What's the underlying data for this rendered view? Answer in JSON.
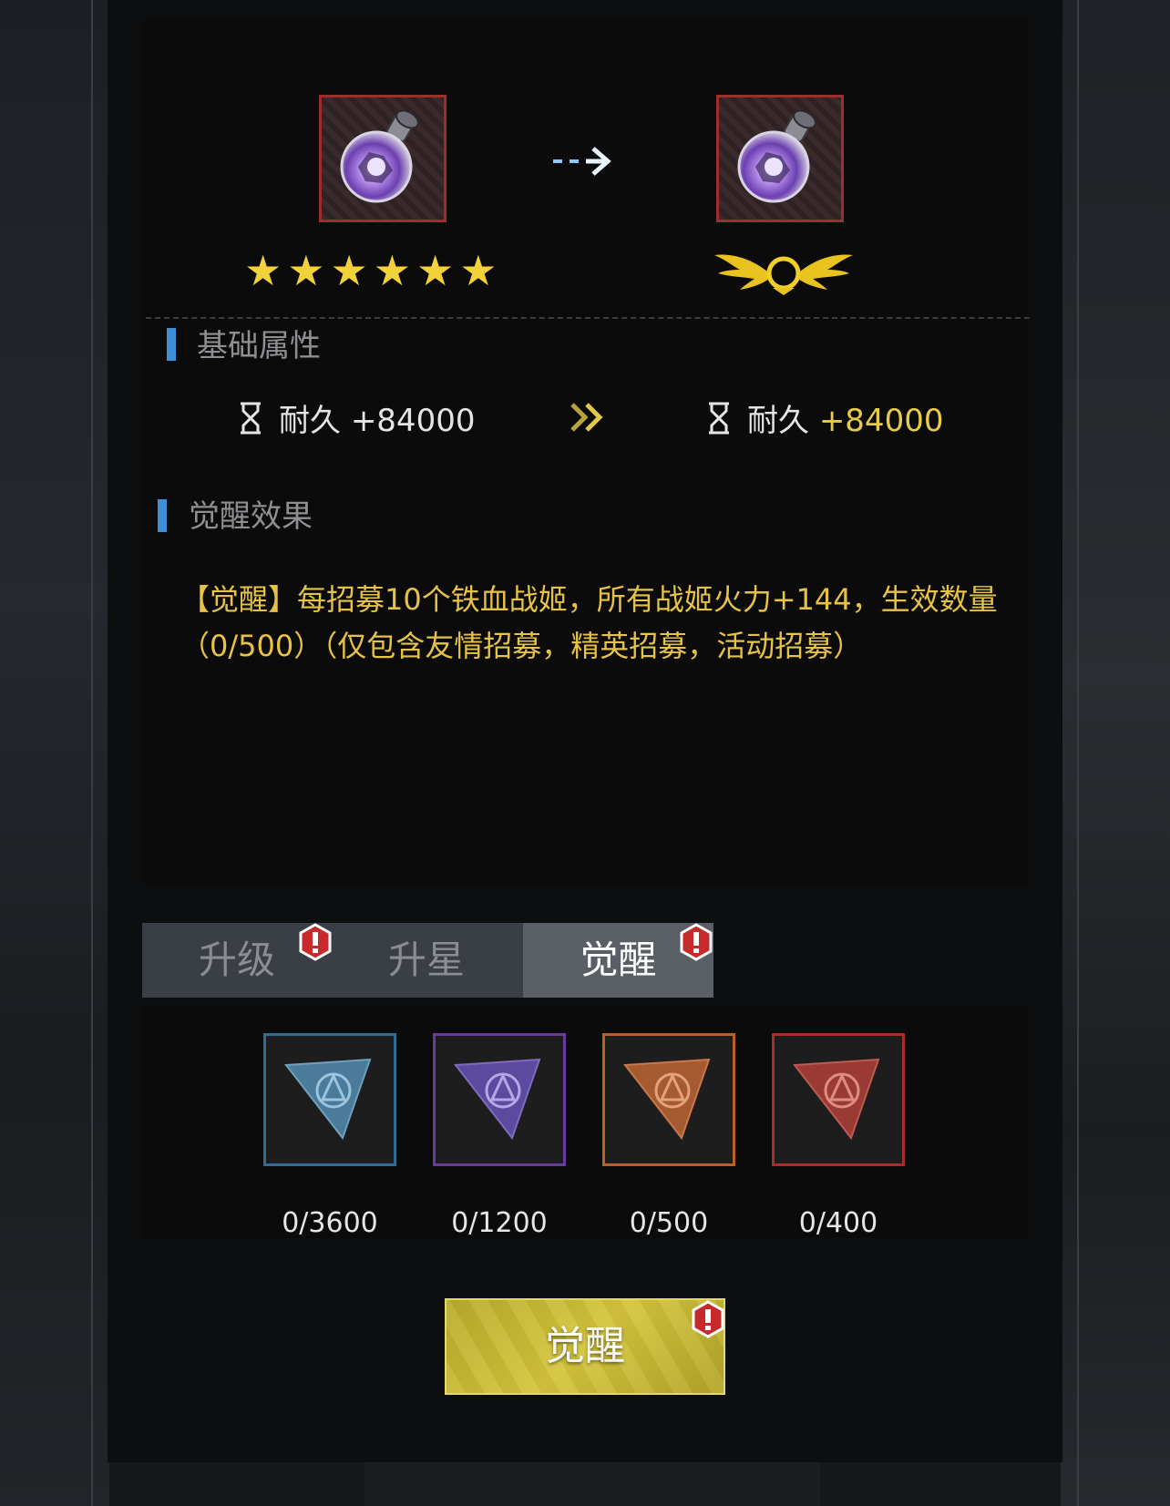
{
  "top": {
    "stars": "★★★★★★"
  },
  "base_attr": {
    "title": "基础属性",
    "before_label": "耐久",
    "before_value": "+84000",
    "after_label": "耐久",
    "after_value": "+84000"
  },
  "awaken_effect": {
    "title": "觉醒效果",
    "text": "【觉醒】每招募10个铁血战姬，所有战姬火力+144，生效数量（0/500）（仅包含友情招募，精英招募，活动招募）"
  },
  "tabs": [
    {
      "label": "升级",
      "alert": true
    },
    {
      "label": "升星",
      "alert": false
    },
    {
      "label": "觉醒",
      "alert": true,
      "active": true
    }
  ],
  "materials": [
    {
      "count": "0/3600",
      "color": "#2f6d96",
      "icon": "blue-core-chip-icon"
    },
    {
      "count": "0/1200",
      "color": "#6b3a9e",
      "icon": "purple-core-chip-icon"
    },
    {
      "count": "0/500",
      "color": "#b9602a",
      "icon": "orange-core-chip-icon"
    },
    {
      "count": "0/400",
      "color": "#a3302d",
      "icon": "red-core-chip-icon"
    }
  ],
  "action": {
    "label": "觉醒"
  }
}
